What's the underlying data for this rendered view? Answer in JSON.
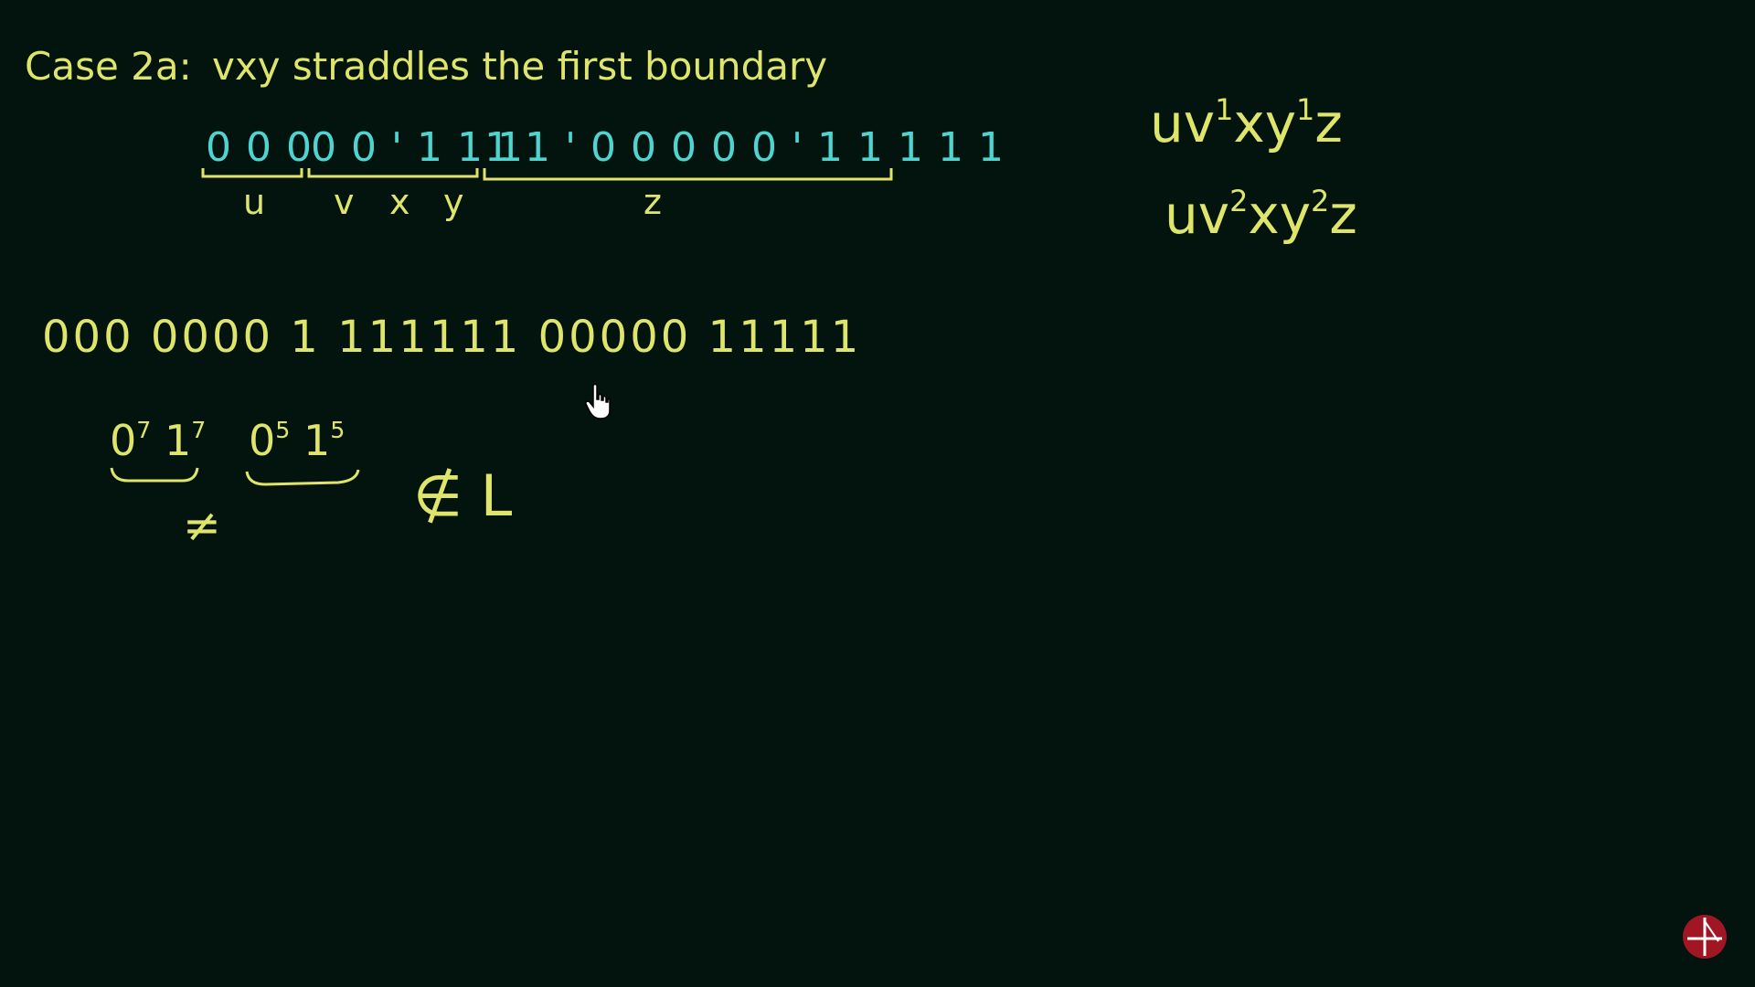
{
  "heading": {
    "label": "Case 2a:",
    "text": "vxy straddles the first boundary"
  },
  "typed_string": {
    "segment_u": "0 0 0",
    "segment_vxy": "0 0 ' 1 1 1",
    "segment_z": "1 1 ' 0 0 0 0 0 ' 1 1 1 1 1",
    "labels": {
      "u": "u",
      "v": "v",
      "x": "x",
      "y": "y",
      "z": "z"
    }
  },
  "handwritten": {
    "pumped_string": "000 0000 1 111111 00000 11111",
    "group_1_base": "0",
    "group_1_exp": "7",
    "group_1_base2": "1",
    "group_1_exp2": "7",
    "group_2_base": "0",
    "group_2_exp": "5",
    "group_2_base2": "1",
    "group_2_exp2": "5",
    "neq": "≠",
    "notin": "∉ L"
  },
  "formulas": {
    "f1_a": "uv",
    "f1_exp1": "1",
    "f1_b": "xy",
    "f1_exp2": "1",
    "f1_c": "z",
    "f2_a": "uv",
    "f2_exp1": "2",
    "f2_b": "xy",
    "f2_exp2": "2",
    "f2_c": "z"
  },
  "colors": {
    "chalk_yellow": "#dfe56a",
    "chalk_cyan": "#4fd4cf",
    "board": "#03140f",
    "logo_red": "#a01622"
  },
  "icons": {
    "cursor": "hand-pointer-icon",
    "logo": "channel-logo-icon"
  }
}
